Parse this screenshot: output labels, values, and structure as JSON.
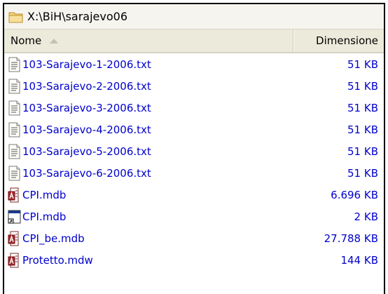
{
  "path_bar": {
    "text": "X:\\BiH\\sarajevo06",
    "icon": "folder-icon"
  },
  "columns": {
    "name": "Nome",
    "size": "Dimensione",
    "sort": "ascending"
  },
  "accent_color": "#0000cc",
  "files": [
    {
      "name": "103-Sarajevo-1-2006.txt",
      "size": "51 KB",
      "icon": "text-file-icon"
    },
    {
      "name": "103-Sarajevo-2-2006.txt",
      "size": "51 KB",
      "icon": "text-file-icon"
    },
    {
      "name": "103-Sarajevo-3-2006.txt",
      "size": "51 KB",
      "icon": "text-file-icon"
    },
    {
      "name": "103-Sarajevo-4-2006.txt",
      "size": "51 KB",
      "icon": "text-file-icon"
    },
    {
      "name": "103-Sarajevo-5-2006.txt",
      "size": "51 KB",
      "icon": "text-file-icon"
    },
    {
      "name": "103-Sarajevo-6-2006.txt",
      "size": "51 KB",
      "icon": "text-file-icon"
    },
    {
      "name": "CPI.mdb",
      "size": "6.696 KB",
      "icon": "access-database-icon"
    },
    {
      "name": "CPI.mdb",
      "size": "2 KB",
      "icon": "shortcut-file-icon"
    },
    {
      "name": "CPI_be.mdb",
      "size": "27.788 KB",
      "icon": "access-database-icon"
    },
    {
      "name": "Protetto.mdw",
      "size": "144 KB",
      "icon": "access-database-icon"
    }
  ]
}
